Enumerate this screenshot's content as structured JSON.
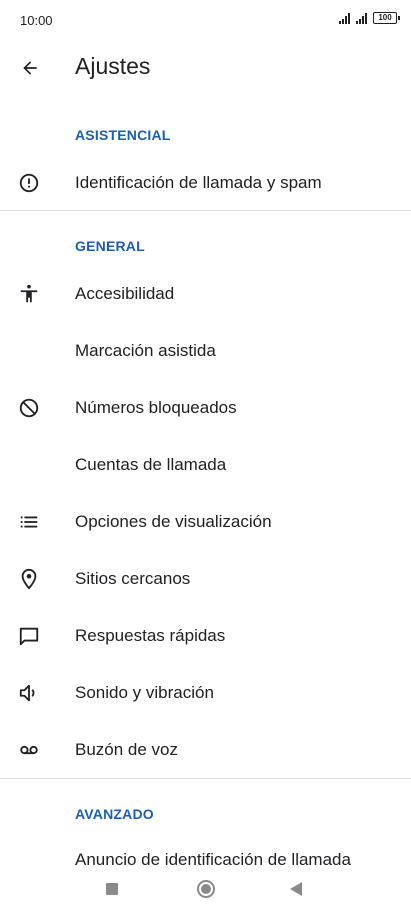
{
  "status": {
    "time": "10:00",
    "battery": "100"
  },
  "header": {
    "title": "Ajustes"
  },
  "sections": {
    "asistencial": "ASISTENCIAL",
    "general": "GENERAL",
    "avanzado": "AVANZADO"
  },
  "items": {
    "caller_id": "Identificación de llamada y spam",
    "accessibility": "Accesibilidad",
    "assisted_dialing": "Marcación asistida",
    "blocked_numbers": "Números bloqueados",
    "calling_accounts": "Cuentas de llamada",
    "display_options": "Opciones de visualización",
    "nearby_places": "Sitios cercanos",
    "quick_responses": "Respuestas rápidas",
    "sound_vibration": "Sonido y vibración",
    "voicemail": "Buzón de voz",
    "caller_id_announce": "Anuncio de identificación de llamada"
  },
  "colors": {
    "accent": "#1a5fb4",
    "text": "#202124",
    "divider": "#dadce0"
  }
}
